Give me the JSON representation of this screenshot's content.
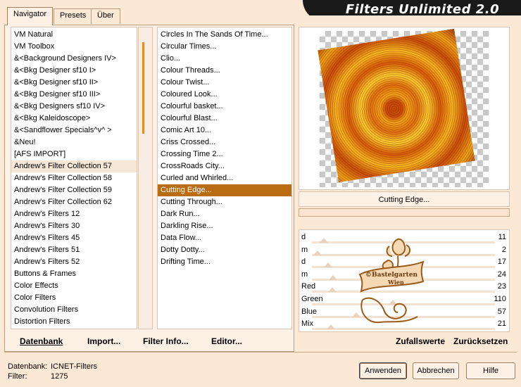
{
  "tabs": [
    {
      "label": "Navigator",
      "active": true
    },
    {
      "label": "Presets",
      "active": false
    },
    {
      "label": "Über",
      "active": false
    }
  ],
  "app_title": "Filters Unlimited 2.0",
  "categories": [
    "VM Natural",
    "VM Toolbox",
    "&<Background Designers IV>",
    "&<Bkg Designer sf10 I>",
    "&<Bkg Designer sf10 II>",
    "&<Bkg Designer sf10 III>",
    "&<Bkg Designers sf10 IV>",
    "&<Bkg Kaleidoscope>",
    "&<Sandflower Specials^v^ >",
    "&Neu!",
    "[AFS IMPORT]",
    "Andrew's Filter Collection 57",
    "Andrew's Filter Collection 58",
    "Andrew's Filter Collection 59",
    "Andrew's Filter Collection 62",
    "Andrew's Filters 12",
    "Andrew's Filters 30",
    "Andrew's Filters 45",
    "Andrew's Filters 51",
    "Andrew's Filters 52",
    "Buttons & Frames",
    "Color Effects",
    "Color Filters",
    "Convolution Filters",
    "Distortion Filters"
  ],
  "selected_category_index": 11,
  "filters": [
    "Circles In The Sands Of Time...",
    "Circular Times...",
    "Clio...",
    "Colour Threads...",
    "Colour Twist...",
    "Coloured Look...",
    "Colourful basket...",
    "Colourful Blast...",
    "Comic Art 10...",
    "Criss Crossed...",
    "Crossing Time 2...",
    "CrossRoads City...",
    "Curled and Whirled...",
    "Cutting Edge...",
    "Cutting Through...",
    "Dark Run...",
    "Darkling Rise...",
    "Data Flow...",
    "Dotty Dotty...",
    "Drifting Time..."
  ],
  "selected_filter_index": 13,
  "left_buttons": {
    "datenbank": "Datenbank",
    "import": "Import...",
    "filter_info": "Filter Info...",
    "editor": "Editor..."
  },
  "preview_filter_name": "Cutting Edge...",
  "params": [
    {
      "label": "d",
      "value": "11",
      "level": 0.043
    },
    {
      "label": "m",
      "value": "2",
      "level": 0.008
    },
    {
      "label": "d",
      "value": "17",
      "level": 0.067
    },
    {
      "label": "m",
      "value": "24",
      "level": 0.094
    },
    {
      "label": "Red",
      "value": "23",
      "level": 0.09
    },
    {
      "label": "Green",
      "value": "110",
      "level": 0.431
    },
    {
      "label": "Blue",
      "value": "57",
      "level": 0.224
    },
    {
      "label": "Mix",
      "value": "21",
      "level": 0.082
    }
  ],
  "watermark": {
    "line1": "©Bastelgarten",
    "line2": "Wien"
  },
  "right_buttons": {
    "random": "Zufallswerte",
    "reset": "Zurücksetzen"
  },
  "status": {
    "db_label": "Datenbank:",
    "db_value": "ICNET-Filters",
    "filter_label": "Filter:",
    "filter_value": "1275"
  },
  "dialog_buttons": {
    "apply": "Anwenden",
    "cancel": "Abbrechen",
    "help": "Hilfe"
  },
  "colors": {
    "accent": "#b86c14",
    "background": "#fbe9d6"
  }
}
